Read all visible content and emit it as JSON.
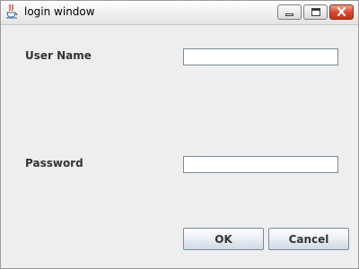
{
  "window": {
    "title": "login window",
    "controls": {
      "minimize": "minimize-icon",
      "maximize": "maximize-icon",
      "close": "close-icon"
    },
    "app_icon": "java-cup-icon"
  },
  "form": {
    "username_label": "User Name",
    "username_value": "",
    "password_label": "Password",
    "password_value": ""
  },
  "buttons": {
    "ok_label": "OK",
    "cancel_label": "Cancel"
  },
  "colors": {
    "window_bg": "#eeeeee",
    "close_button": "#d9452a"
  }
}
